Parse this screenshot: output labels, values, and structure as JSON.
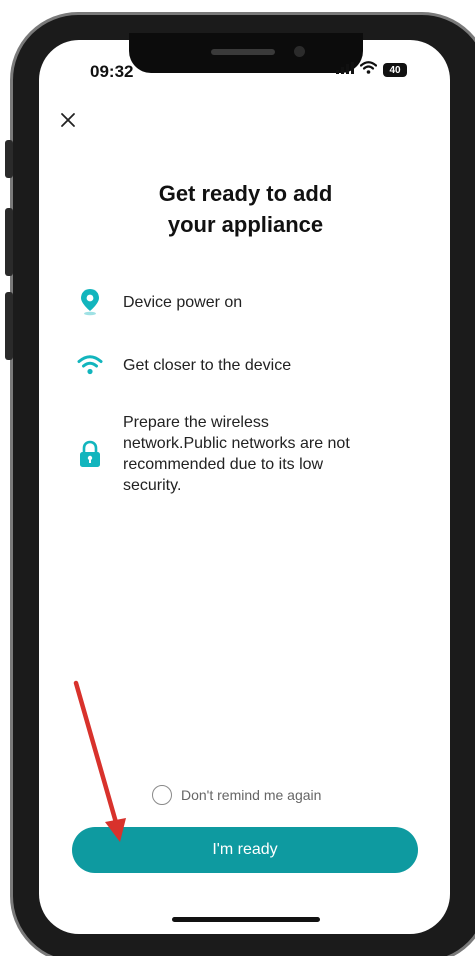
{
  "status_bar": {
    "time": "09:32",
    "battery": "40"
  },
  "header": {
    "close_label": "×"
  },
  "main": {
    "title": "Get ready to add\nyour appliance",
    "items": [
      {
        "icon": "location-pin-icon",
        "label": "Device power on"
      },
      {
        "icon": "wifi-icon",
        "label": "Get closer to the device"
      },
      {
        "icon": "lock-icon",
        "label": "Prepare the wireless network.Public networks are not recommended due to its low security."
      }
    ]
  },
  "footer": {
    "remind_label": "Don't remind me again",
    "ready_label": "I'm ready"
  },
  "colors": {
    "accent": "#0e9aa0",
    "icon": "#12b5bd",
    "annotation_arrow": "#d8322c"
  }
}
